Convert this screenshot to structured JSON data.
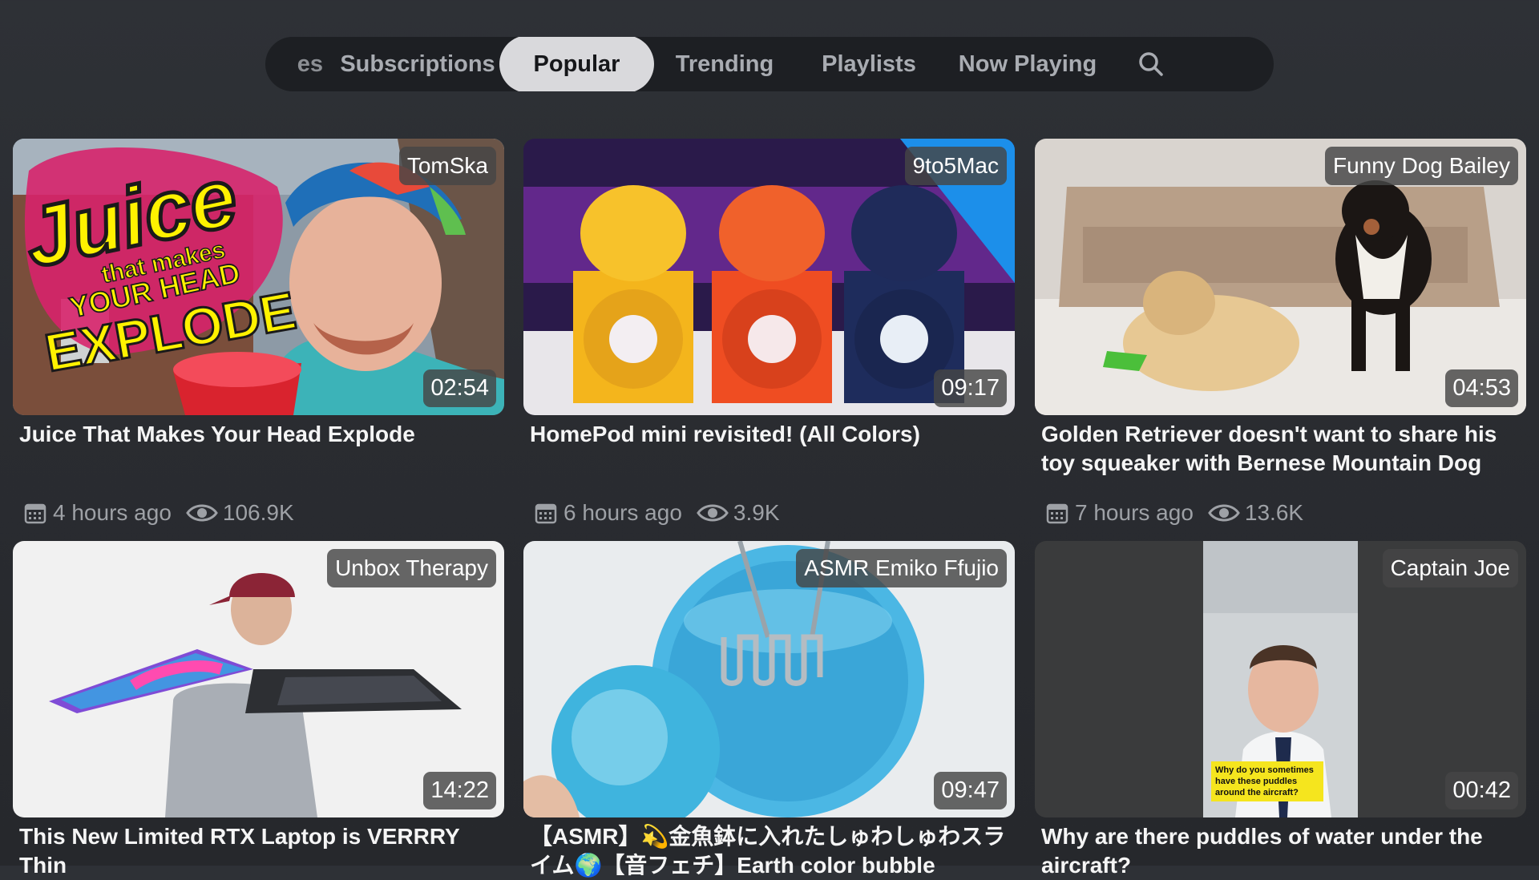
{
  "nav": {
    "items": [
      {
        "label": "es",
        "state": "cut-off"
      },
      {
        "label": "Subscriptions"
      },
      {
        "label": "Popular",
        "selected": true
      },
      {
        "label": "Trending"
      },
      {
        "label": "Playlists"
      },
      {
        "label": "Now Playing"
      }
    ],
    "search_icon": "search-icon"
  },
  "videos": [
    {
      "channel": "TomSka",
      "duration": "02:54",
      "title": "Juice That Makes Your Head Explode",
      "age": "4 hours ago",
      "views": "106.9K",
      "thumb_text": [
        "Juice",
        "that makes",
        "YOUR HEAD",
        "EXPLODE"
      ]
    },
    {
      "channel": "9to5Mac",
      "duration": "09:17",
      "title": "HomePod mini revisited! (All Colors)",
      "age": "6 hours ago",
      "views": "3.9K"
    },
    {
      "channel": "Funny Dog Bailey",
      "duration": "04:53",
      "title": "Golden Retriever doesn't want to share his toy squeaker with Bernese Mountain Dog",
      "age": "7 hours ago",
      "views": "13.6K"
    },
    {
      "channel": "Unbox Therapy",
      "duration": "14:22",
      "title": "This New Limited RTX Laptop is VERRRY Thin"
    },
    {
      "channel": "ASMR Emiko Ffujio",
      "duration": "09:47",
      "title": "【ASMR】💫金魚鉢に入れたしゅわしゅわスライム🌍【音フェチ】Earth color bubble"
    },
    {
      "channel": "Captain Joe",
      "duration": "00:42",
      "title": "Why are there puddles of water under the aircraft?",
      "thumb_text": [
        "Why do you sometimes",
        "have these puddles",
        "around the aircraft?"
      ]
    }
  ],
  "colors": {
    "selected_tab_bg": "#d9d9dc",
    "nav_bg": "#1d1f23",
    "background": "#2a2c31"
  },
  "icons": {
    "date": "calendar-icon",
    "views": "eye-icon"
  }
}
